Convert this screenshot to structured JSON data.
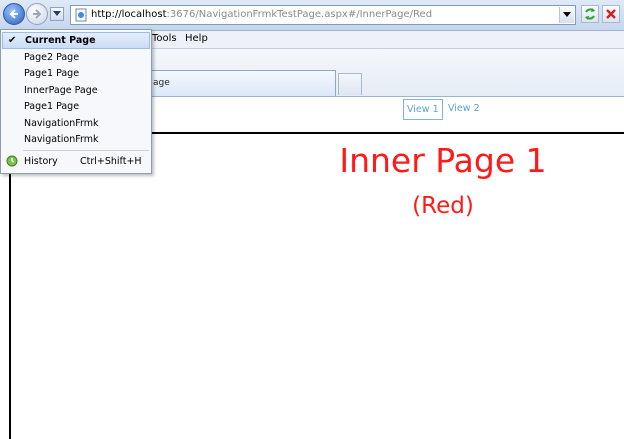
{
  "browser": {
    "url_host": "http://localhost",
    "url_rest": ":3676/NavigationFrmkTestPage.aspx#/InnerPage/Red"
  },
  "menubar": {
    "tools": "Tools",
    "help": "Help"
  },
  "tab": {
    "label": "age"
  },
  "history_menu": {
    "items": [
      {
        "label": "Current Page",
        "current": true
      },
      {
        "label": "Page2 Page"
      },
      {
        "label": "Page1 Page"
      },
      {
        "label": "InnerPage Page"
      },
      {
        "label": "Page1 Page"
      },
      {
        "label": "NavigationFrmk"
      },
      {
        "label": "NavigationFrmk"
      }
    ],
    "history_label": "History",
    "history_shortcut": "Ctrl+Shift+H",
    "check_glyph": "✔"
  },
  "page": {
    "view1": "View 1",
    "view2": "View 2",
    "title": "Inner Page 1",
    "subtitle": "(Red)",
    "title_color": "#ff1a1a",
    "link_color": "#5aa0d8"
  }
}
